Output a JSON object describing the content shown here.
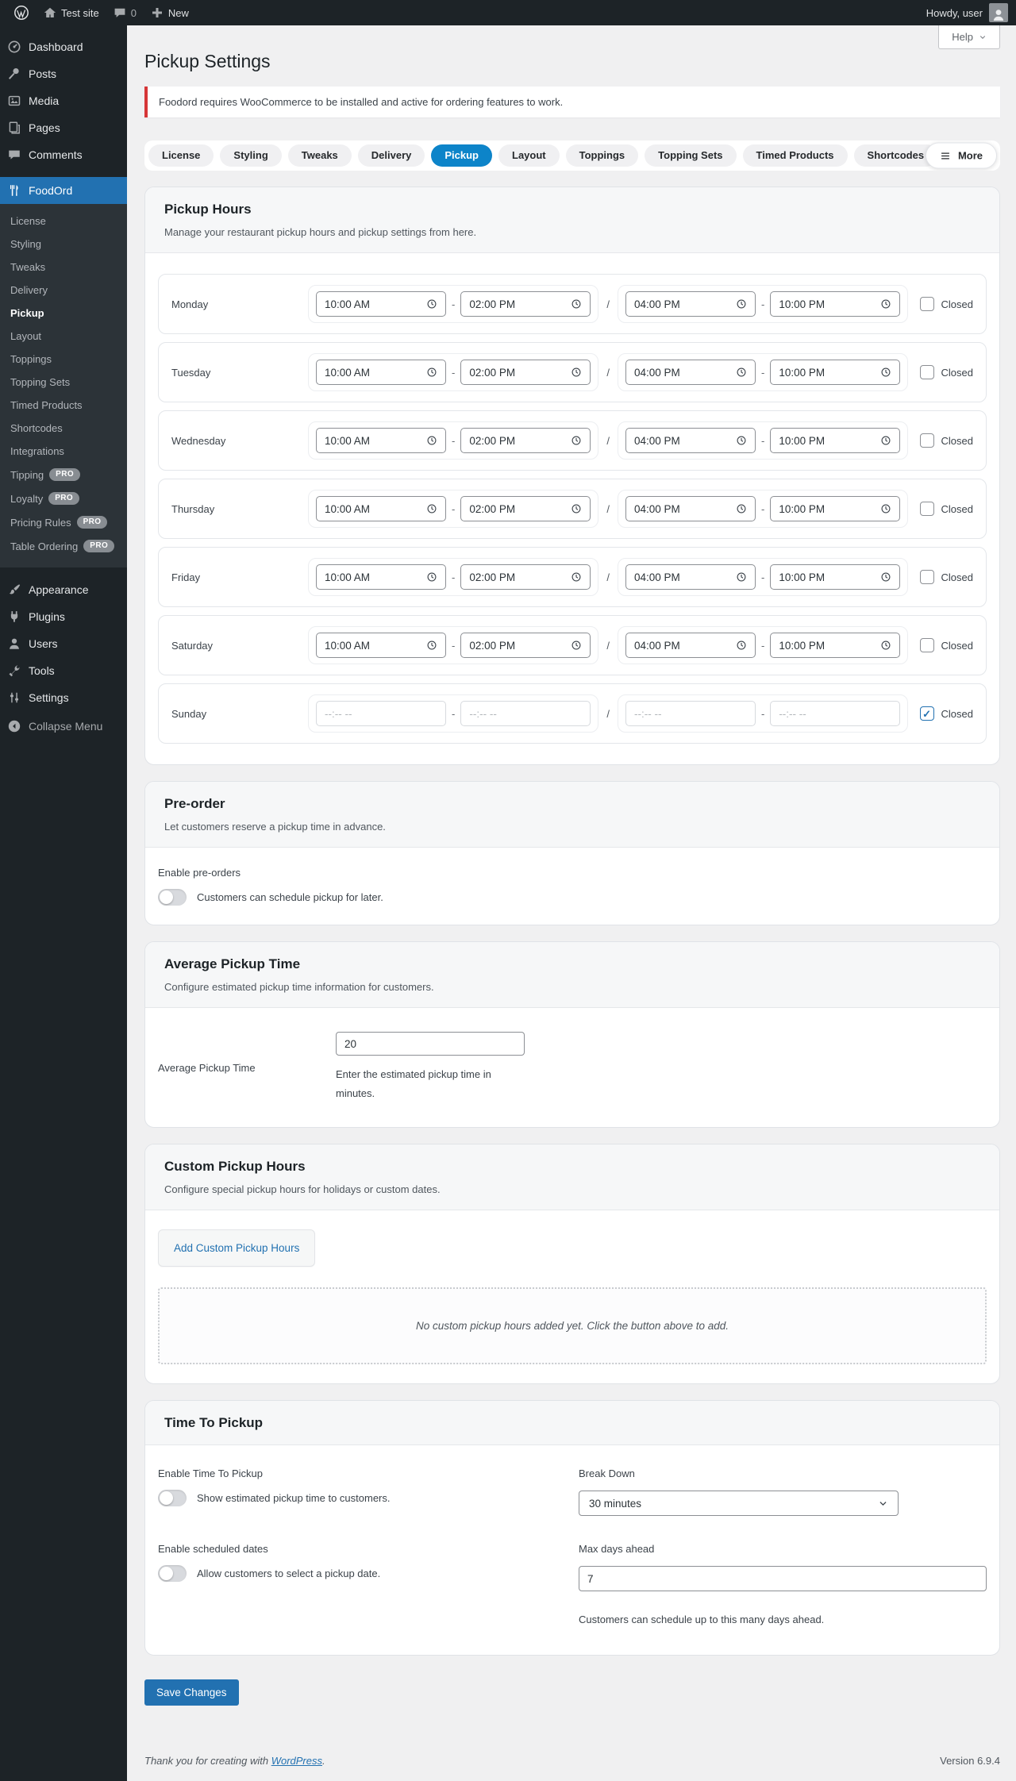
{
  "admin_bar": {
    "site_name": "Test site",
    "comments_count": "0",
    "new_label": "New",
    "howdy": "Howdy, user"
  },
  "sidebar": {
    "top_items": [
      {
        "label": "Dashboard",
        "icon": "dashboard-icon"
      },
      {
        "label": "Posts",
        "icon": "posts-icon"
      },
      {
        "label": "Media",
        "icon": "media-icon"
      },
      {
        "label": "Pages",
        "icon": "pages-icon"
      },
      {
        "label": "Comments",
        "icon": "comments-icon"
      }
    ],
    "foodord": {
      "label": "FoodOrd",
      "icon": "restaurant-icon",
      "submenu": [
        {
          "label": "License"
        },
        {
          "label": "Styling"
        },
        {
          "label": "Tweaks"
        },
        {
          "label": "Delivery"
        },
        {
          "label": "Pickup",
          "current": true
        },
        {
          "label": "Layout"
        },
        {
          "label": "Toppings"
        },
        {
          "label": "Topping Sets"
        },
        {
          "label": "Timed Products"
        },
        {
          "label": "Shortcodes"
        },
        {
          "label": "Integrations"
        },
        {
          "label": "Tipping",
          "badge": "PRO"
        },
        {
          "label": "Loyalty",
          "badge": "PRO"
        },
        {
          "label": "Pricing Rules",
          "badge": "PRO"
        },
        {
          "label": "Table Ordering",
          "badge": "PRO"
        }
      ]
    },
    "bottom_items": [
      {
        "label": "Appearance",
        "icon": "appearance-icon"
      },
      {
        "label": "Plugins",
        "icon": "plugins-icon"
      },
      {
        "label": "Users",
        "icon": "users-icon"
      },
      {
        "label": "Tools",
        "icon": "tools-icon"
      },
      {
        "label": "Settings",
        "icon": "settings-icon"
      }
    ],
    "collapse_label": "Collapse Menu"
  },
  "page": {
    "title": "Pickup Settings",
    "help_label": "Help",
    "notice": "Foodord requires WooCommerce to be installed and active for ordering features to work."
  },
  "tabs": {
    "items": [
      "License",
      "Styling",
      "Tweaks",
      "Delivery",
      "Pickup",
      "Layout",
      "Toppings",
      "Topping Sets",
      "Timed Products",
      "Shortcodes"
    ],
    "active": "Pickup",
    "more_label": "More"
  },
  "pickup_hours": {
    "title": "Pickup Hours",
    "description": "Manage your restaurant pickup hours and pickup settings from here.",
    "closed_label": "Closed",
    "empty_time": "--:-- --",
    "days": [
      {
        "name": "Monday",
        "slot1": [
          "10:00 AM",
          "02:00 PM"
        ],
        "slot2": [
          "04:00 PM",
          "10:00 PM"
        ],
        "closed": false
      },
      {
        "name": "Tuesday",
        "slot1": [
          "10:00 AM",
          "02:00 PM"
        ],
        "slot2": [
          "04:00 PM",
          "10:00 PM"
        ],
        "closed": false
      },
      {
        "name": "Wednesday",
        "slot1": [
          "10:00 AM",
          "02:00 PM"
        ],
        "slot2": [
          "04:00 PM",
          "10:00 PM"
        ],
        "closed": false
      },
      {
        "name": "Thursday",
        "slot1": [
          "10:00 AM",
          "02:00 PM"
        ],
        "slot2": [
          "04:00 PM",
          "10:00 PM"
        ],
        "closed": false
      },
      {
        "name": "Friday",
        "slot1": [
          "10:00 AM",
          "02:00 PM"
        ],
        "slot2": [
          "04:00 PM",
          "10:00 PM"
        ],
        "closed": false
      },
      {
        "name": "Saturday",
        "slot1": [
          "10:00 AM",
          "02:00 PM"
        ],
        "slot2": [
          "04:00 PM",
          "10:00 PM"
        ],
        "closed": false
      },
      {
        "name": "Sunday",
        "slot1": null,
        "slot2": null,
        "closed": true
      }
    ]
  },
  "preorder": {
    "title": "Pre-order",
    "description": "Let customers reserve a pickup time in advance.",
    "toggle_label": "Enable pre-orders",
    "toggle_on": false,
    "toggle_help": "Customers can schedule pickup for later."
  },
  "average_pickup": {
    "title": "Average Pickup Time",
    "description": "Configure estimated pickup time information for customers.",
    "field_label": "Average Pickup Time",
    "value": "20",
    "help": "Enter the estimated pickup time in minutes."
  },
  "custom_hours": {
    "title": "Custom Pickup Hours",
    "description": "Configure special pickup hours for holidays or custom dates.",
    "add_button": "Add Custom Pickup Hours",
    "empty_text": "No custom pickup hours added yet. Click the button above to add."
  },
  "time_to_pickup": {
    "title": "Time To Pickup",
    "enable_label": "Enable Time To Pickup",
    "enable_help": "Show estimated pickup time to customers.",
    "enable_on": false,
    "breakdown_label": "Break Down",
    "breakdown_value": "30 minutes",
    "scheduled_label": "Enable scheduled dates",
    "scheduled_help": "Allow customers to select a pickup date.",
    "scheduled_on": false,
    "max_days_label": "Max days ahead",
    "max_days_value": "7",
    "max_days_help": "Customers can schedule up to this many days ahead."
  },
  "save_label": "Save Changes",
  "footer": {
    "thanks_prefix": "Thank you for creating with ",
    "wordpress_link": "WordPress",
    "thanks_suffix": ".",
    "version": "Version 6.9.4"
  },
  "colors": {
    "accent_blue": "#2271b1",
    "tab_active_blue": "#0d84c9",
    "notice_red": "#d63638",
    "adminbar_bg": "#1d2327",
    "submenu_bg": "#2c3338"
  }
}
